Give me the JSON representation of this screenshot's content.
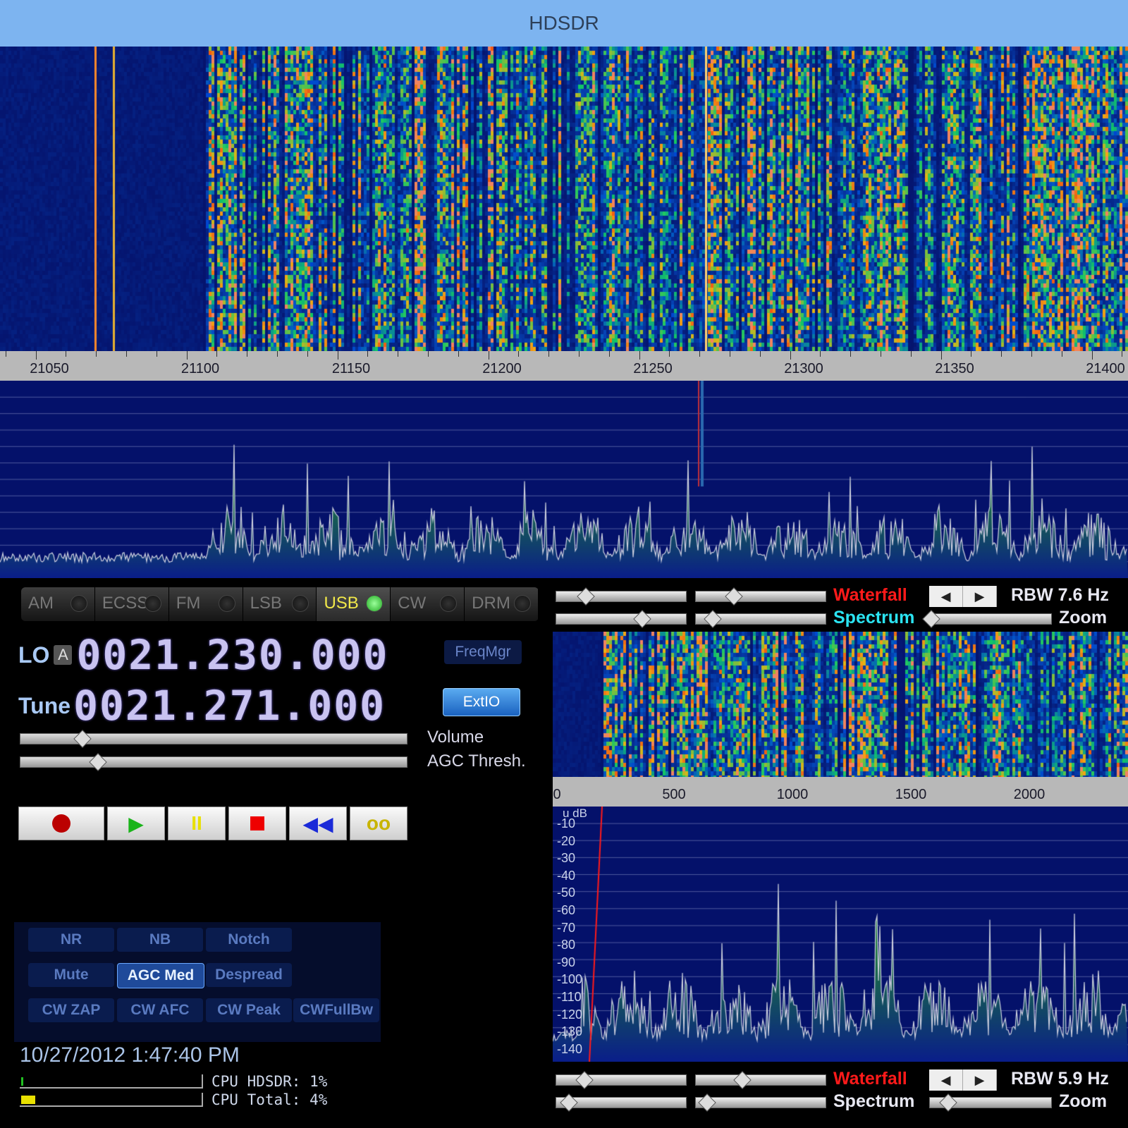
{
  "window": {
    "title": "HDSDR"
  },
  "top_axis": {
    "labels": [
      "21050",
      "21100",
      "21150",
      "21200",
      "21250",
      "21300",
      "21350",
      "21400"
    ]
  },
  "modes": [
    {
      "label": "AM",
      "active": false
    },
    {
      "label": "ECSS",
      "active": false
    },
    {
      "label": "FM",
      "active": false
    },
    {
      "label": "LSB",
      "active": false
    },
    {
      "label": "USB",
      "active": true
    },
    {
      "label": "CW",
      "active": false
    },
    {
      "label": "DRM",
      "active": false
    }
  ],
  "lo": {
    "label": "LO",
    "badge": "A",
    "value": "0021.230.000"
  },
  "tune": {
    "label": "Tune",
    "value": "0021.271.000"
  },
  "buttons": {
    "freqmgr": "FreqMgr",
    "extio": "ExtIO"
  },
  "sliders": {
    "volume_label": "Volume",
    "volume": 0.16,
    "agc_label": "AGC Thresh.",
    "agc": 0.2
  },
  "dsp": {
    "nr": "NR",
    "nb": "NB",
    "notch": "Notch",
    "mute": "Mute",
    "agc": "AGC Med",
    "despread": "Despread",
    "cwzap": "CW ZAP",
    "cwafc": "CW AFC",
    "cwpeak": "CW Peak",
    "cwfullbw": "CWFullBw"
  },
  "status": {
    "datetime": "10/27/2012 1:47:40 PM",
    "cpu_hdsdr_label": "CPU HDSDR:  1%",
    "cpu_hdsdr": 0.01,
    "cpu_total_label": "CPU Total:  4%",
    "cpu_total": 0.04
  },
  "ctl_top": {
    "waterfall": "Waterfall",
    "spectrum": "Spectrum",
    "rbw": "RBW  7.6 Hz",
    "zoom": "Zoom"
  },
  "ctl_bot": {
    "waterfall": "Waterfall",
    "spectrum": "Spectrum",
    "rbw": "RBW  5.9 Hz",
    "zoom": "Zoom"
  },
  "bot_axis": {
    "labels": [
      "0",
      "500",
      "1000",
      "1500",
      "2000"
    ]
  },
  "bot_spectrum": {
    "db_unit": "u dB",
    "db_labels": [
      "-10",
      "-20",
      "-30",
      "-40",
      "-50",
      "-60",
      "-70",
      "-80",
      "-90",
      "-100",
      "-110",
      "-120",
      "-130",
      "-140"
    ]
  },
  "colors": {
    "title_bg": "#7db4f0",
    "waterfall_bg": "#04116a",
    "accent_red": "#ff1a1a",
    "accent_cyan": "#2be4f2"
  }
}
